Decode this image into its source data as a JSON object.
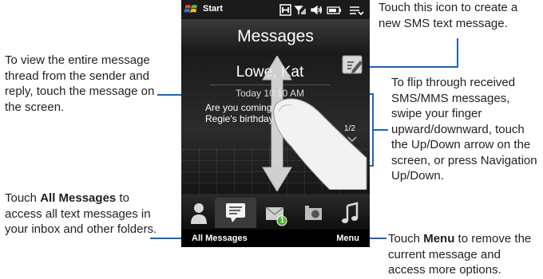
{
  "phone": {
    "status_bar": {
      "start_label": "Start"
    },
    "title": "Messages",
    "message_card": {
      "sender": "Lowe, Kat",
      "date": "Today 10:10 AM",
      "body": "Are you coming tonight to Regie's birthday party?"
    },
    "page_indicator": "1/2",
    "tabs": [
      {
        "icon": "contacts-icon"
      },
      {
        "icon": "messages-icon",
        "active": true
      },
      {
        "icon": "email-icon",
        "badge": "1"
      },
      {
        "icon": "camera-icon"
      },
      {
        "icon": "music-icon"
      }
    ],
    "softkeys": {
      "left": "All Messages",
      "right": "Menu"
    }
  },
  "callouts": {
    "new_sms": "Touch this icon to create a new SMS text message.",
    "view_thread": "To view the entire message thread from the sender and reply, touch the message on the screen.",
    "flip_messages": "To flip through received SMS/MMS messages, swipe your finger upward/downward, touch the Up/Down arrow on the screen, or press Navigation Up/Down.",
    "all_messages_pre": "Touch ",
    "all_messages_bold": "All Messages",
    "all_messages_post": " to access all text messages in your inbox and other folders.",
    "menu_pre": "Touch ",
    "menu_bold": "Menu",
    "menu_post": " to remove the current message and access more options."
  },
  "colors": {
    "callout_line": "#1f63b8",
    "phone_bg": "#000000",
    "badge": "#4caf2a"
  }
}
